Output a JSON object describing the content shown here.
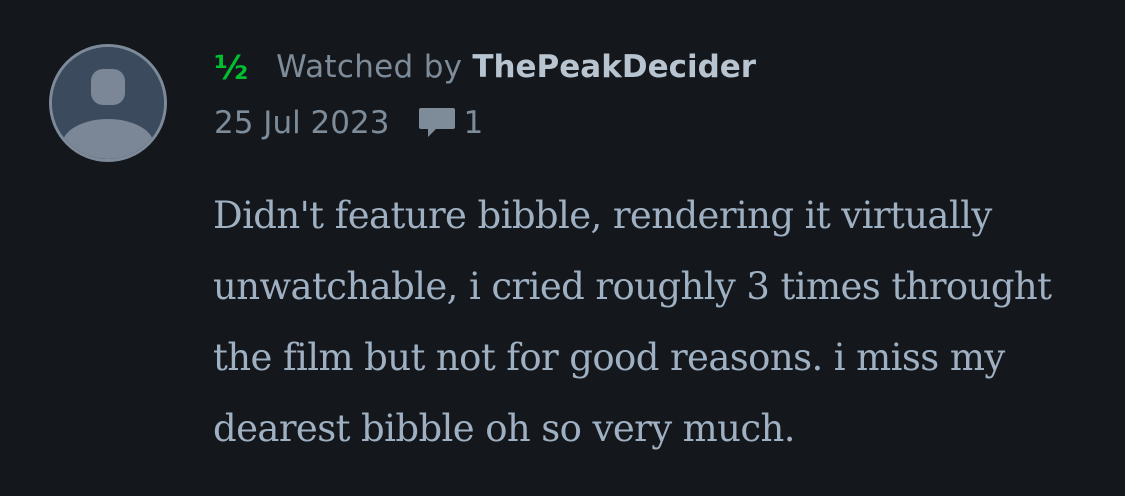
{
  "review": {
    "rating": "½",
    "watched_by_label": "Watched by",
    "username": "ThePeakDecider",
    "date": "25 Jul 2023",
    "comment_count": "1",
    "text": "Didn't feature bibble, rendering it virtually unwatchable, i cried roughly 3 times throught the film but not for good reasons. i miss my dearest bibble oh so very much."
  },
  "icons": {
    "avatar": "user-avatar-icon",
    "comment": "comment-icon"
  },
  "colors": {
    "background": "#14181c",
    "rating_green": "#00c030",
    "muted_text": "#7e8b99",
    "username_text": "#b8c4d0",
    "body_text": "#9fb0c2"
  }
}
